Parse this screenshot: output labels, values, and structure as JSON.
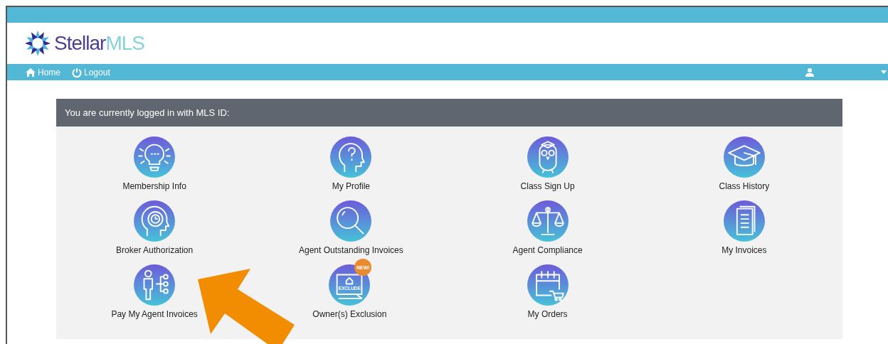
{
  "logo": {
    "primary": "Stellar",
    "secondary": "MLS"
  },
  "nav": {
    "items": [
      {
        "label": "Home",
        "kind": "home"
      },
      {
        "label": "Logout",
        "kind": "power"
      }
    ]
  },
  "panel": {
    "title": "You are currently logged in with MLS ID:",
    "tiles": [
      {
        "label": "Membership Info",
        "kind": "bulb"
      },
      {
        "label": "My Profile",
        "kind": "head-question"
      },
      {
        "label": "Class Sign Up",
        "kind": "owl"
      },
      {
        "label": "Class History",
        "kind": "cap"
      },
      {
        "label": "Broker Authorization",
        "kind": "head-clock"
      },
      {
        "label": "Agent Outstanding Invoices",
        "kind": "magnifier"
      },
      {
        "label": "Agent Compliance",
        "kind": "scales"
      },
      {
        "label": "My Invoices",
        "kind": "documents"
      },
      {
        "label": "Pay My Agent Invoices",
        "kind": "person-network"
      },
      {
        "label": "Owner(s) Exclusion",
        "kind": "exclude",
        "icon_text": "EXCLUDE",
        "badge": "NEW!"
      },
      {
        "label": "My Orders",
        "kind": "calendar-cart"
      }
    ]
  }
}
